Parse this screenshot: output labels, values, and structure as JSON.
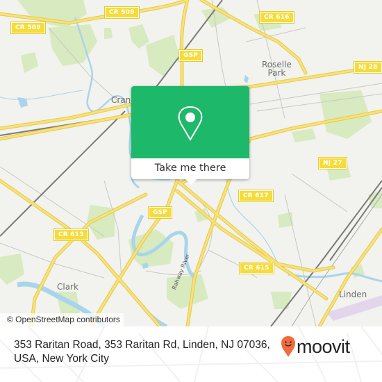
{
  "map": {
    "road_shields": [
      {
        "label": "CR 509",
        "id": "cr509-west"
      },
      {
        "label": "CR 509",
        "id": "cr509-north"
      },
      {
        "label": "CR 616",
        "id": "cr616"
      },
      {
        "label": "GSP",
        "id": "gsp-north"
      },
      {
        "label": "NJ 28",
        "id": "nj28"
      },
      {
        "label": "NJ 27",
        "id": "nj27"
      },
      {
        "label": "CR 617",
        "id": "cr617"
      },
      {
        "label": "GSP",
        "id": "gsp-south"
      },
      {
        "label": "CR 613",
        "id": "cr613"
      },
      {
        "label": "CR 615",
        "id": "cr615"
      }
    ],
    "places": {
      "roselle_park_line1": "Roselle",
      "roselle_park_line2": "Park",
      "cranford": "Cranford",
      "clark": "Clark",
      "linden": "Linden"
    },
    "water_labels": {
      "rahway_river": "Rahway River"
    },
    "colors": {
      "background": "#f2f2ee",
      "road_major": "#f7e27a",
      "road_casing": "#e6c94a",
      "water": "#a8d5ec",
      "park": "#d4e8b8",
      "rail": "#777777"
    }
  },
  "popup": {
    "icon": "map-pin-icon",
    "action_label": "Take me there",
    "accent_color": "#1db869"
  },
  "attribution": "© OpenStreetMap contributors",
  "footer": {
    "address": "353 Raritan Road, 353 Raritan Rd, Linden, NJ 07036, USA, New York City",
    "brand": "moovit",
    "brand_icon": "moovit-pin-icon",
    "brand_color": "#f26b3a"
  }
}
